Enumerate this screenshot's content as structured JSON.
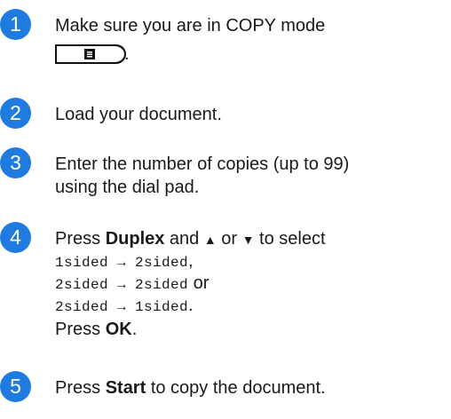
{
  "steps": [
    {
      "number": "1",
      "line1": "Make sure you are in COPY mode",
      "line2_suffix": ".",
      "copy_key_icon": "copy-document-icon"
    },
    {
      "number": "2",
      "line1": "Load your document."
    },
    {
      "number": "3",
      "line1": "Enter the number of copies (up to 99)",
      "line2": "using the dial pad."
    },
    {
      "number": "4",
      "press": "Press ",
      "duplex": "Duplex",
      "and": " and ",
      "up_arrow": "▲",
      "or": " or ",
      "down_arrow": "▼",
      "to_select": " to select",
      "option1": "1sided → 2sided",
      "option1_suffix": ",",
      "option2": "2sided → 2sided",
      "option2_suffix": " or",
      "option3": "2sided → 1sided",
      "option3_suffix": ".",
      "press_ok_prefix": "Press ",
      "ok": "OK",
      "press_ok_suffix": "."
    },
    {
      "number": "5",
      "press": "Press ",
      "start": "Start",
      "rest": " to copy the document."
    }
  ],
  "colors": {
    "badge": "#1f7be0"
  }
}
